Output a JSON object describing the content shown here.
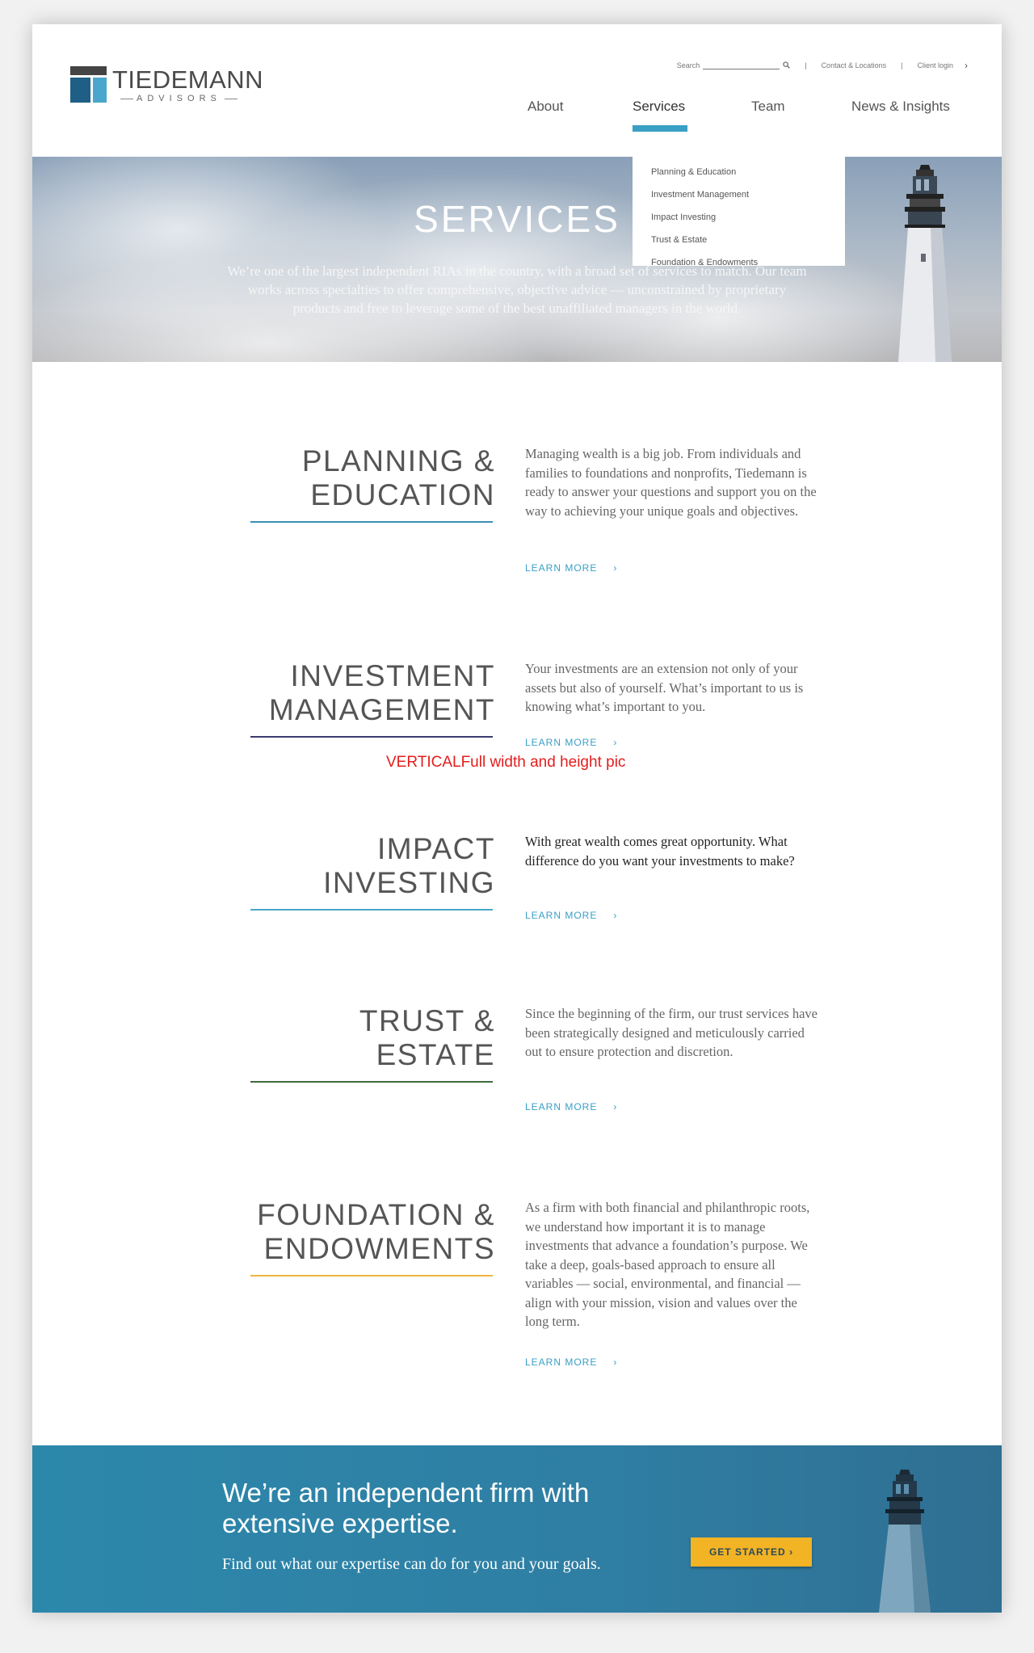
{
  "logo": {
    "name": "TIEDEMANN",
    "sub": "ADVISORS"
  },
  "utility": {
    "search_label": "Search",
    "contact": "Contact & Locations",
    "login": "Client login",
    "separator": "|"
  },
  "nav": {
    "items": [
      {
        "label": "About"
      },
      {
        "label": "Services"
      },
      {
        "label": "Team"
      },
      {
        "label": "News & Insights"
      }
    ]
  },
  "dropdown": {
    "items": [
      {
        "label": "Planning & Education"
      },
      {
        "label": "Investment Management"
      },
      {
        "label": "Impact Investing"
      },
      {
        "label": "Trust & Estate"
      },
      {
        "label": "Foundation & Endowments"
      }
    ]
  },
  "hero": {
    "title": "SERVICES",
    "text": "We’re one of the largest independent RIAs in the country, with a broad set of services to match. Our team works across specialties to offer comprehensive, objective advice — unconstrained by proprietary products and free to leverage some of the best unaffiliated managers in the world."
  },
  "services": [
    {
      "title_line1": "PLANNING &",
      "title_line2": "EDUCATION",
      "text": "Managing wealth is a big job. From individuals and families to foundations and nonprofits, Tiedemann is ready to answer your questions and support you on the way to achieving your unique goals and objectives.",
      "link": "LEARN MORE",
      "rule_color": "#3a8fb4"
    },
    {
      "title_line1": "INVESTMENT",
      "title_line2": "MANAGEMENT",
      "text": "Your investments are an extension not only of your assets but also of yourself. What’s important to us is knowing what’s important to you.",
      "link": "LEARN MORE",
      "rule_color": "#3b3b72"
    },
    {
      "title_line1": "IMPACT",
      "title_line2": "INVESTING",
      "text": "With great wealth comes great opportunity. What difference do you want your investments to make?",
      "link": "LEARN MORE",
      "rule_color": "#4aa6cc"
    },
    {
      "title_line1": "TRUST &",
      "title_line2": "ESTATE",
      "text": "Since the beginning of the firm, our trust services have been strategically designed and meticulously carried out to ensure protection and discretion.",
      "link": "LEARN MORE",
      "rule_color": "#3e6b3a"
    },
    {
      "title_line1": "FOUNDATION &",
      "title_line2": "ENDOWMENTS",
      "text": "As a firm with both financial and philanthropic roots, we understand how important it is to manage investments that advance a foundation’s purpose. We take a deep, goals-based approach to ensure all variables — social, environmental, and financial — align with your mission, vision and values over the long term.",
      "link": "LEARN MORE",
      "rule_color": "#f0b440"
    }
  ],
  "note": "VERTICALFull width and height pic",
  "banner": {
    "title": "We’re an independent firm with extensive expertise.",
    "subtitle": "Find out what our expertise can do for you and your goals.",
    "cta": "GET STARTED"
  },
  "icons": {
    "search": "search-icon",
    "chevron": "chevron-right-icon"
  }
}
